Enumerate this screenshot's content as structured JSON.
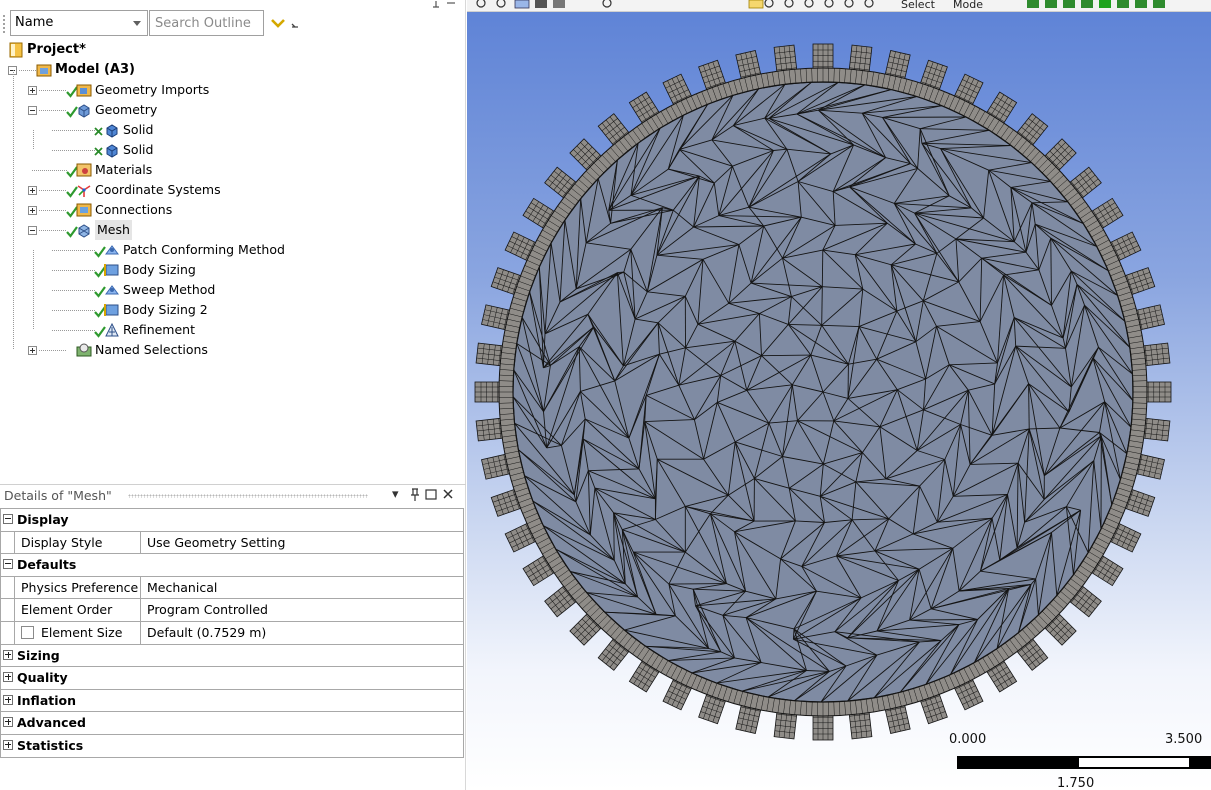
{
  "outline": {
    "filter_field": "Name",
    "search_placeholder": "Search Outline",
    "tree": [
      {
        "label": "Project*",
        "level": 0,
        "bold": true,
        "expander": "none",
        "icon": "project-icon",
        "status": "none"
      },
      {
        "label": "Model (A3)",
        "level": 1,
        "bold": true,
        "expander": "minus",
        "icon": "model-icon",
        "status": "none"
      },
      {
        "label": "Geometry Imports",
        "level": 2,
        "bold": false,
        "expander": "plus",
        "icon": "geometry-imports-icon",
        "status": "check"
      },
      {
        "label": "Geometry",
        "level": 2,
        "bold": false,
        "expander": "minus",
        "icon": "geometry-icon",
        "status": "check"
      },
      {
        "label": "Solid",
        "level": 3,
        "bold": false,
        "expander": "none",
        "icon": "solid-body-icon",
        "status": "check-x"
      },
      {
        "label": "Solid",
        "level": 3,
        "bold": false,
        "expander": "none",
        "icon": "solid-body-icon",
        "status": "check-x"
      },
      {
        "label": "Materials",
        "level": 2,
        "bold": false,
        "expander": "none",
        "icon": "materials-icon",
        "status": "check"
      },
      {
        "label": "Coordinate Systems",
        "level": 2,
        "bold": false,
        "expander": "plus",
        "icon": "coordinate-systems-icon",
        "status": "check"
      },
      {
        "label": "Connections",
        "level": 2,
        "bold": false,
        "expander": "plus",
        "icon": "connections-icon",
        "status": "check"
      },
      {
        "label": "Mesh",
        "level": 2,
        "bold": false,
        "expander": "minus",
        "icon": "mesh-icon",
        "status": "check",
        "selected": true
      },
      {
        "label": "Patch Conforming Method",
        "level": 3,
        "bold": false,
        "expander": "none",
        "icon": "method-icon",
        "status": "check"
      },
      {
        "label": "Body Sizing",
        "level": 3,
        "bold": false,
        "expander": "none",
        "icon": "sizing-icon",
        "status": "check"
      },
      {
        "label": "Sweep Method",
        "level": 3,
        "bold": false,
        "expander": "none",
        "icon": "method-icon",
        "status": "check"
      },
      {
        "label": "Body Sizing 2",
        "level": 3,
        "bold": false,
        "expander": "none",
        "icon": "sizing-icon",
        "status": "check"
      },
      {
        "label": "Refinement",
        "level": 3,
        "bold": false,
        "expander": "none",
        "icon": "refinement-icon",
        "status": "check"
      },
      {
        "label": "Named Selections",
        "level": 2,
        "bold": false,
        "expander": "plus",
        "icon": "named-selections-icon",
        "status": "none"
      }
    ]
  },
  "details": {
    "title": "Details of \"Mesh\"",
    "rows": [
      {
        "type": "category",
        "label": "Display",
        "expanded": true
      },
      {
        "type": "property",
        "key": "Display Style",
        "value": "Use Geometry Setting",
        "checkbox": false
      },
      {
        "type": "category",
        "label": "Defaults",
        "expanded": true
      },
      {
        "type": "property",
        "key": "Physics Preference",
        "value": "Mechanical",
        "checkbox": false
      },
      {
        "type": "property",
        "key": "Element Order",
        "value": "Program Controlled",
        "checkbox": false
      },
      {
        "type": "property",
        "key": "Element Size",
        "value": "Default (0.7529 m)",
        "checkbox": true
      },
      {
        "type": "category",
        "label": "Sizing",
        "expanded": false
      },
      {
        "type": "category",
        "label": "Quality",
        "expanded": false
      },
      {
        "type": "category",
        "label": "Inflation",
        "expanded": false
      },
      {
        "type": "category",
        "label": "Advanced",
        "expanded": false
      },
      {
        "type": "category",
        "label": "Statistics",
        "expanded": false
      }
    ]
  },
  "viewport": {
    "toolbar": {
      "select_label": "Select",
      "mode_label": "Mode"
    },
    "scale": {
      "left": "0.000",
      "right": "3.500",
      "middle": "1.750"
    },
    "colors": {
      "mesh_face": "#7f8ba3",
      "mesh_edge": "#141414",
      "ring_face": "#8f8c88",
      "accent": "#3a8f2a"
    }
  }
}
